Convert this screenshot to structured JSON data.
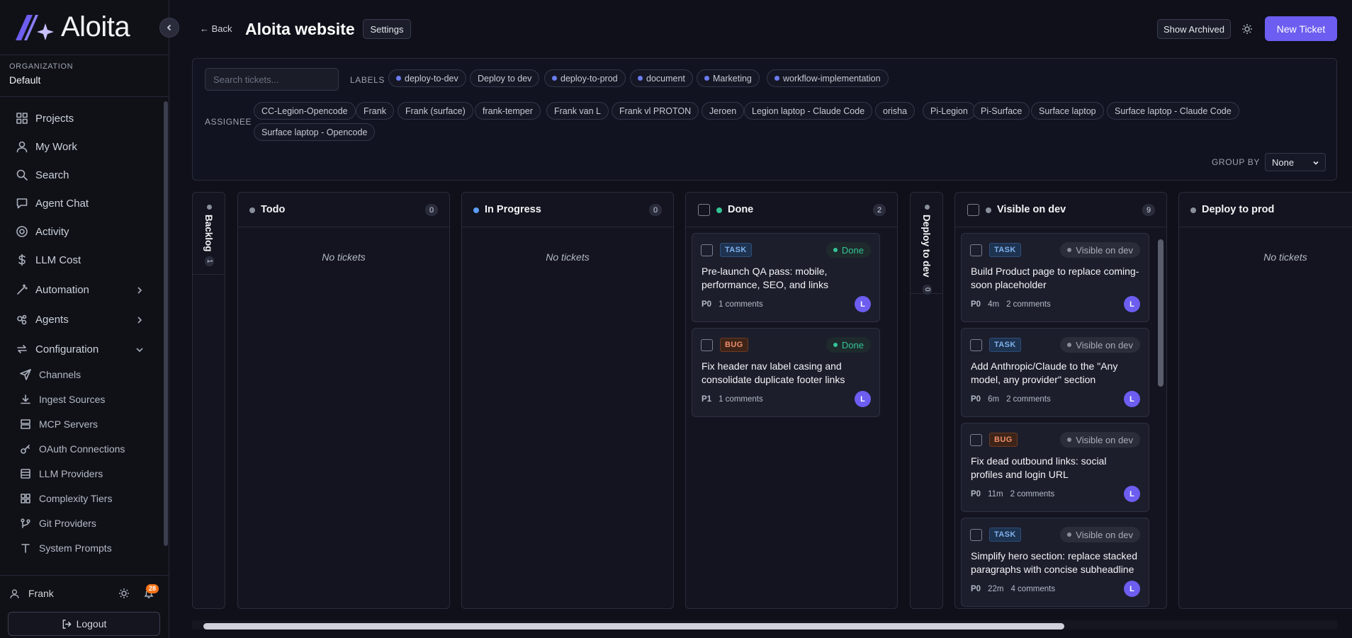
{
  "app": {
    "name": "Aloita"
  },
  "colors": {
    "accent": "#6d5df0",
    "done": "#34c496",
    "task": "#7fb2ee",
    "bug": "#ee8d6a",
    "label_dot": "#6b7cf0",
    "badge": "#f97316"
  },
  "org": {
    "label": "ORGANIZATION",
    "name": "Default"
  },
  "nav": {
    "items": [
      {
        "label": "Projects",
        "icon": "grid-icon"
      },
      {
        "label": "My Work",
        "icon": "user-icon"
      },
      {
        "label": "Search",
        "icon": "search-icon"
      },
      {
        "label": "Agent Chat",
        "icon": "chat-icon"
      },
      {
        "label": "Activity",
        "icon": "target-icon"
      },
      {
        "label": "LLM Cost",
        "icon": "dollar-icon"
      },
      {
        "label": "Automation",
        "icon": "wand-icon",
        "expandable": true
      },
      {
        "label": "Agents",
        "icon": "bot-icon",
        "expandable": true
      },
      {
        "label": "Configuration",
        "icon": "refresh-icon",
        "expanded": true
      }
    ],
    "config_items": [
      {
        "label": "Channels",
        "icon": "send-icon"
      },
      {
        "label": "Ingest Sources",
        "icon": "download-icon"
      },
      {
        "label": "MCP Servers",
        "icon": "server-icon"
      },
      {
        "label": "OAuth Connections",
        "icon": "key-icon"
      },
      {
        "label": "LLM Providers",
        "icon": "database-icon"
      },
      {
        "label": "Complexity Tiers",
        "icon": "grid-icon"
      },
      {
        "label": "Git Providers",
        "icon": "git-icon"
      },
      {
        "label": "System Prompts",
        "icon": "text-icon"
      }
    ]
  },
  "user": {
    "name": "Frank",
    "notifications": "28",
    "logout": "Logout"
  },
  "header": {
    "back": "← Back",
    "title": "Aloita website",
    "settings": "Settings",
    "show_archived": "Show Archived",
    "new_ticket": "New Ticket"
  },
  "filters": {
    "search_placeholder": "Search tickets...",
    "labels_title": "LABELS",
    "labels": [
      {
        "text": "deploy-to-dev",
        "dot": true
      },
      {
        "text": "Deploy to dev",
        "dot": false
      },
      {
        "text": "deploy-to-prod",
        "dot": true
      },
      {
        "text": "document",
        "dot": true
      },
      {
        "text": "Marketing",
        "dot": true
      },
      {
        "text": "workflow-implementation",
        "dot": true
      }
    ],
    "assignee_title": "ASSIGNEE",
    "assignees": [
      "CC-Legion-Opencode",
      "Frank",
      "Frank (surface)",
      "frank-temper",
      "Frank van L",
      "Frank vl PROTON",
      "Jeroen",
      "Legion laptop - Claude Code",
      "orisha",
      "Pi-Legion",
      "Pi-Surface",
      "Surface laptop",
      "Surface laptop - Claude Code",
      "Surface laptop - Opencode"
    ],
    "group_by_title": "GROUP BY",
    "group_by_value": "None"
  },
  "board": {
    "empty_text": "No tickets",
    "columns": [
      {
        "name": "Backlog",
        "count": "1",
        "collapsed": true
      },
      {
        "name": "Todo",
        "count": "0"
      },
      {
        "name": "In Progress",
        "count": "0"
      },
      {
        "name": "Done",
        "count": "2"
      },
      {
        "name": "Deploy to dev",
        "count": "0",
        "collapsed": true
      },
      {
        "name": "Visible on dev",
        "count": "9"
      },
      {
        "name": "Deploy to prod",
        "count": ""
      }
    ],
    "done_cards": [
      {
        "type": "TASK",
        "status": "Done",
        "title": "Pre-launch QA pass: mobile, performance, SEO, and links",
        "priority": "P0",
        "age": "",
        "comments": "1 comments",
        "avatar": "L"
      },
      {
        "type": "BUG",
        "status": "Done",
        "title": "Fix header nav label casing and consolidate duplicate footer links",
        "priority": "P1",
        "age": "",
        "comments": "1 comments",
        "avatar": "L"
      }
    ],
    "dev_cards": [
      {
        "type": "TASK",
        "status": "Visible on dev",
        "title": "Build Product page to replace coming-soon placeholder",
        "priority": "P0",
        "age": "4m",
        "comments": "2 comments",
        "avatar": "L"
      },
      {
        "type": "TASK",
        "status": "Visible on dev",
        "title": "Add Anthropic/Claude to the \"Any model, any provider\" section",
        "priority": "P0",
        "age": "6m",
        "comments": "2 comments",
        "avatar": "L"
      },
      {
        "type": "BUG",
        "status": "Visible on dev",
        "title": "Fix dead outbound links: social profiles and login URL",
        "priority": "P0",
        "age": "11m",
        "comments": "2 comments",
        "avatar": "L"
      },
      {
        "type": "TASK",
        "status": "Visible on dev",
        "title": "Simplify hero section: replace stacked paragraphs with concise subheadline",
        "priority": "P0",
        "age": "22m",
        "comments": "4 comments",
        "avatar": "L"
      }
    ]
  }
}
